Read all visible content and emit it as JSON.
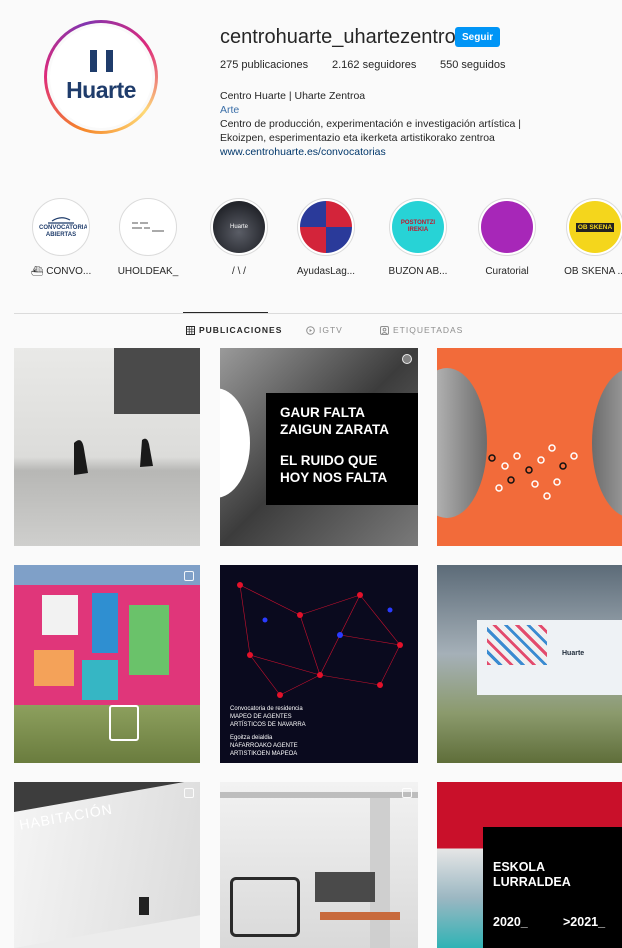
{
  "profile": {
    "username": "centrohuarte_uhartezentroa",
    "follow_label": "Seguir",
    "avatar_word": "Huarte",
    "stats": {
      "posts": "275 publicaciones",
      "followers": "2.162 seguidores",
      "following": "550 seguidos"
    },
    "display_name": "Centro Huarte | Uharte Zentroa",
    "category": "Arte",
    "bio_line1": "Centro de producción, experimentación e investigación artística |",
    "bio_line2": "Ekoizpen, esperimentazio eta ikerketa artistikorako zentroa",
    "website": "www.centrohuarte.es/convocatorias"
  },
  "highlights": [
    {
      "label": "⛴ CONVO...",
      "cover_text": "CONVOCATORIA ABIERTAS",
      "bg": "#ffffff"
    },
    {
      "label": "UHOLDEAK_",
      "cover_text": "",
      "bg": "#ffffff"
    },
    {
      "label": "/ \\ /",
      "cover_text": "Huarte",
      "bg": "#2b2d33"
    },
    {
      "label": "AyudasLag...",
      "cover_text": "",
      "bg": "#d3243a"
    },
    {
      "label": "BUZÓN AB...",
      "cover_text": "POSTONTZI IREKIA",
      "bg": "#27d3d6"
    },
    {
      "label": "Curatorial",
      "cover_text": "",
      "bg": "#a727b8"
    },
    {
      "label": "OB SKENA ...",
      "cover_text": "OB SKENA",
      "bg": "#f4d61c"
    }
  ],
  "tabs": [
    {
      "label": "PUBLICACIONES",
      "icon": "grid-icon",
      "active": true
    },
    {
      "label": "IGTV",
      "icon": "igtv-icon",
      "active": false
    },
    {
      "label": "ETIQUETADAS",
      "icon": "tagged-icon",
      "active": false
    }
  ],
  "posts": {
    "p2_line1": "GAUR FALTA",
    "p2_line2": "ZAIGUN ZARATA",
    "p2_line3": "EL RUIDO QUE",
    "p2_line4": "HOY NOS FALTA",
    "p5_line1": "Convocatoria de residencia",
    "p5_line2": "MAPEO DE AGENTES",
    "p5_line3": "ARTÍSTICOS DE NAVARRA",
    "p5_line4": "Egoitza deialdia",
    "p5_line5": "NAFARROAKO AGENTE",
    "p5_line6": "ARTISTIKOEN MAPEOA",
    "p6_sign": "Huarte",
    "p7_wall": "HABITACIÓN",
    "p9_line1": "ESKOLA",
    "p9_line2": "LURRALDEA",
    "p9_y1": "2020_",
    "p9_y2": ">2021_"
  }
}
